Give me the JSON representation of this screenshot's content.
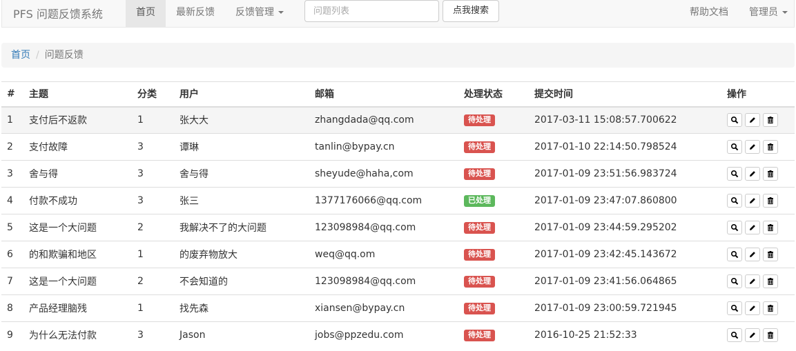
{
  "navbar": {
    "brand": "PFS 问题反馈系统",
    "items": [
      {
        "label": "首页",
        "active": true
      },
      {
        "label": "最新反馈",
        "active": false
      },
      {
        "label": "反馈管理",
        "active": false,
        "dropdown": true
      }
    ],
    "search": {
      "placeholder": "问题列表",
      "value": "",
      "button_label": "点我搜索"
    },
    "right_items": [
      {
        "label": "帮助文档"
      },
      {
        "label": "管理员",
        "dropdown": true
      }
    ]
  },
  "breadcrumb": {
    "home": "首页",
    "current": "问题反馈"
  },
  "table": {
    "headers": [
      "#",
      "主题",
      "分类",
      "用户",
      "邮箱",
      "处理状态",
      "提交时间",
      "操作"
    ],
    "rows": [
      {
        "id": "1",
        "subject": "支付后不返款",
        "category": "1",
        "user": "张大大",
        "email": "zhangdada@qq.com",
        "status": "待处理",
        "time": "2017-03-11 15:08:57.700622"
      },
      {
        "id": "2",
        "subject": "支付故障",
        "category": "3",
        "user": "谭琳",
        "email": "tanlin@bypay.cn",
        "status": "待处理",
        "time": "2017-01-10 22:14:50.798524"
      },
      {
        "id": "3",
        "subject": "舍与得",
        "category": "3",
        "user": "舍与得",
        "email": "sheyude@haha,com",
        "status": "待处理",
        "time": "2017-01-09 23:51:56.983724"
      },
      {
        "id": "4",
        "subject": "付款不成功",
        "category": "3",
        "user": "张三",
        "email": "1377176066@qq.com",
        "status": "已处理",
        "time": "2017-01-09 23:47:07.860800"
      },
      {
        "id": "5",
        "subject": "这是一个大问题",
        "category": "2",
        "user": "我解决不了的大问题",
        "email": "123098984@qq.com",
        "status": "待处理",
        "time": "2017-01-09 23:44:59.295202"
      },
      {
        "id": "6",
        "subject": "的和欺骗和地区",
        "category": "1",
        "user": "的废弃物放大",
        "email": "weq@qq.om",
        "status": "待处理",
        "time": "2017-01-09 23:42:45.143672"
      },
      {
        "id": "7",
        "subject": "这是一个大问题",
        "category": "2",
        "user": "不会知道的",
        "email": "123098984@qq.com",
        "status": "待处理",
        "time": "2017-01-09 23:41:56.064865"
      },
      {
        "id": "8",
        "subject": "产品经理脑残",
        "category": "1",
        "user": "找先森",
        "email": "xiansen@bypay.cn",
        "status": "待处理",
        "time": "2017-01-09 23:00:59.721945"
      },
      {
        "id": "9",
        "subject": "为什么无法付款",
        "category": "3",
        "user": "Jason",
        "email": "jobs@ppzedu.com",
        "status": "待处理",
        "time": "2016-10-25 21:52:33"
      }
    ],
    "actions": [
      "search-icon",
      "pencil-icon",
      "trash-icon"
    ]
  },
  "colors": {
    "pending": "#d9534f",
    "done": "#5cb85c",
    "link": "#337ab7"
  }
}
